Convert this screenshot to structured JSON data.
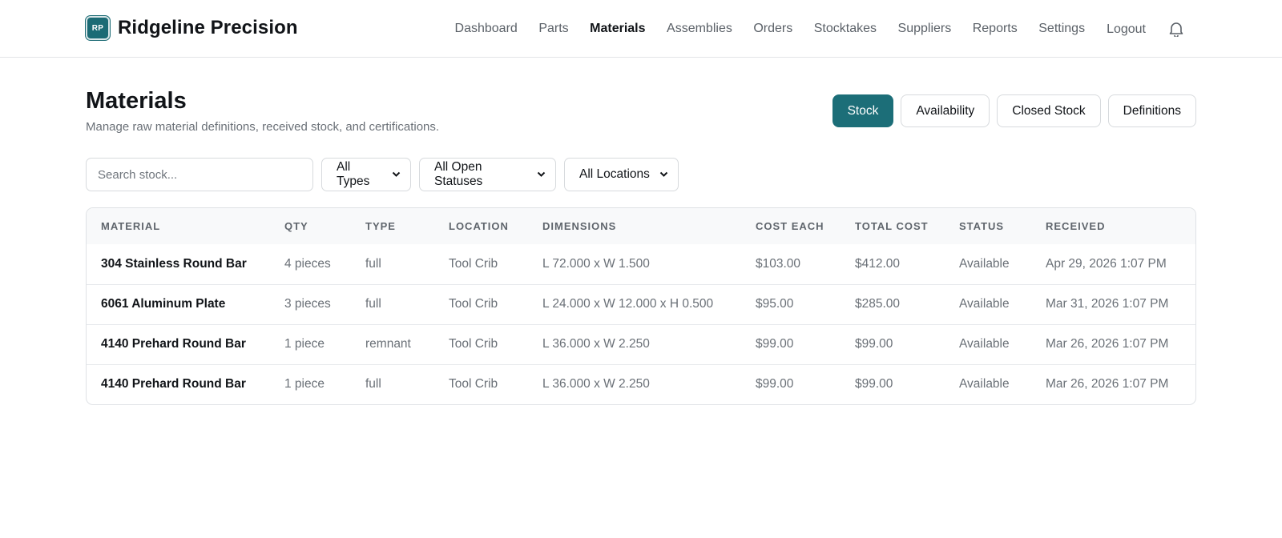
{
  "brand": {
    "logo_text": "RP",
    "name": "Ridgeline Precision"
  },
  "nav": {
    "items": [
      "Dashboard",
      "Parts",
      "Materials",
      "Assemblies",
      "Orders",
      "Stocktakes",
      "Suppliers",
      "Reports",
      "Settings"
    ],
    "active": "Materials",
    "logout": "Logout"
  },
  "page": {
    "title": "Materials",
    "subtitle": "Manage raw material definitions, received stock, and certifications."
  },
  "view_tabs": {
    "items": [
      "Stock",
      "Availability",
      "Closed Stock",
      "Definitions"
    ],
    "active": "Stock"
  },
  "filters": {
    "search_placeholder": "Search stock...",
    "type": "All Types",
    "status": "All Open Statuses",
    "location": "All Locations"
  },
  "table": {
    "columns": [
      "Material",
      "Qty",
      "Type",
      "Location",
      "Dimensions",
      "Cost Each",
      "Total Cost",
      "Status",
      "Received"
    ],
    "rows": [
      [
        "304 Stainless Round Bar",
        "4 pieces",
        "full",
        "Tool Crib",
        "L 72.000 x W 1.500",
        "$103.00",
        "$412.00",
        "Available",
        "Apr 29, 2026 1:07 PM"
      ],
      [
        "6061 Aluminum Plate",
        "3 pieces",
        "full",
        "Tool Crib",
        "L 24.000 x W 12.000 x H 0.500",
        "$95.00",
        "$285.00",
        "Available",
        "Mar 31, 2026 1:07 PM"
      ],
      [
        "4140 Prehard Round Bar",
        "1 piece",
        "remnant",
        "Tool Crib",
        "L 36.000 x W 2.250",
        "$99.00",
        "$99.00",
        "Available",
        "Mar 26, 2026 1:07 PM"
      ],
      [
        "4140 Prehard Round Bar",
        "1 piece",
        "full",
        "Tool Crib",
        "L 36.000 x W 2.250",
        "$99.00",
        "$99.00",
        "Available",
        "Mar 26, 2026 1:07 PM"
      ]
    ]
  },
  "icons": {
    "notifications": "bell-icon",
    "dropdown": "chevron-down-icon"
  },
  "colors": {
    "accent": "#1c6e78"
  }
}
